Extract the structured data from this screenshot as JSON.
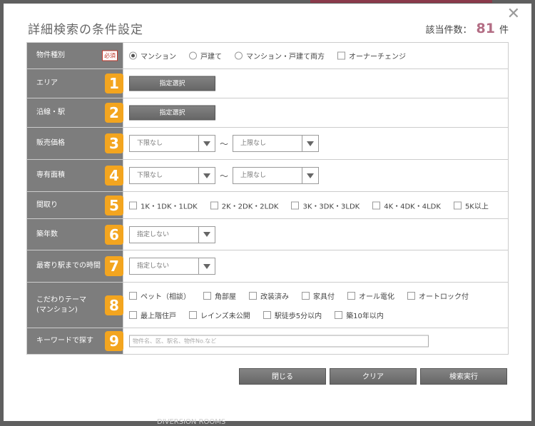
{
  "modal": {
    "title": "詳細検索の条件設定",
    "count_label": "該当件数：",
    "count_value": "81",
    "count_unit": "件",
    "close_icon": "close-icon"
  },
  "rows": {
    "property_type": {
      "label": "物件種別",
      "required": "必須",
      "options": [
        "マンション",
        "戸建て",
        "マンション・戸建て両方"
      ],
      "selected": "マンション",
      "owner_change": "オーナーチェンジ"
    },
    "area": {
      "label": "エリア",
      "num": "1",
      "button": "指定選択"
    },
    "line": {
      "label": "沿線・駅",
      "num": "2",
      "button": "指定選択"
    },
    "price": {
      "label": "販売価格",
      "num": "3",
      "min": "下限なし",
      "tilde": "～",
      "max": "上限なし"
    },
    "floor_area": {
      "label": "専有面積",
      "num": "4",
      "min": "下限なし",
      "tilde": "～",
      "max": "上限なし"
    },
    "layout": {
      "label": "間取り",
      "num": "5",
      "options": [
        "1K・1DK・1LDK",
        "2K・2DK・2LDK",
        "3K・3DK・3LDK",
        "4K・4DK・4LDK",
        "5K以上"
      ]
    },
    "age": {
      "label": "築年数",
      "num": "6",
      "value": "指定しない"
    },
    "station_time": {
      "label": "最寄り駅までの時間",
      "num": "7",
      "value": "指定しない"
    },
    "theme": {
      "label_line1": "こだわりテーマ",
      "label_line2": "(マンション)",
      "num": "8",
      "options_row1": [
        "ペット（相談）",
        "角部屋",
        "改装済み",
        "家具付",
        "オール電化",
        "オートロック付"
      ],
      "options_row2": [
        "最上階住戸",
        "レインズ未公開",
        "駅徒歩5分以内",
        "築10年以内"
      ]
    },
    "keyword": {
      "label": "キーワードで探す",
      "num": "9",
      "placeholder": "物件名、区、駅名、物件No.など"
    }
  },
  "footer": {
    "close": "閉じる",
    "clear": "クリア",
    "search": "検索実行"
  },
  "background_text": "DIVERSION ROOMS"
}
